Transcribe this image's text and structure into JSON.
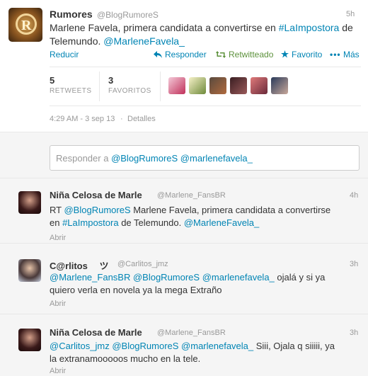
{
  "main_tweet": {
    "name": "Rumores",
    "handle": "@BlogRumoreS",
    "time": "5h",
    "text_parts": [
      "Marlene Favela, primera candidata a convertirse en ",
      "#LaImpostora",
      " de",
      "Telemundo. ",
      "@MarleneFavela_"
    ],
    "actions": {
      "collapse": "Reducir",
      "reply": "Responder",
      "retweeted": "Retwitteado",
      "favorite": "Favorito",
      "more": "Más"
    },
    "stats": {
      "retweets_count": "5",
      "retweets_label": "RETWEETS",
      "favorites_count": "3",
      "favorites_label": "FAVORITOS"
    },
    "timestamp": "4:29 AM - 3 sep 13",
    "details": "Detalles"
  },
  "reply_box": {
    "prefix": "Responder a ",
    "mentions": "@BlogRumoreS @marlenefavela_"
  },
  "replies": [
    {
      "name": "Niña Celosa de Marle",
      "handle": "@Marlene_FansBR",
      "time": "4h",
      "line1_parts": [
        "RT ",
        "@BlogRumoreS",
        " Marlene Favela, primera candidata a convertirse"
      ],
      "line2_parts": [
        "en ",
        "#LaImpostora",
        " de Telemundo. ",
        "@MarleneFavela_"
      ],
      "open": "Abrir"
    },
    {
      "name": "C@rlitos  ツ",
      "handle": "@Carlitos_jmz",
      "time": "3h",
      "line1_parts": [
        "@Marlene_FansBR @BlogRumoreS @marlenefavela_",
        " ojalá y si ya"
      ],
      "line2_parts": [
        "quiero verla en novela ya la mega Extraño"
      ],
      "open": "Abrir"
    },
    {
      "name": "Niña Celosa de Marle",
      "handle": "@Marlene_FansBR",
      "time": "3h",
      "line1_parts": [
        "@Carlitos_jmz @BlogRumoreS @marlenefavela_",
        " Siii, Ojala q siiiii, ya"
      ],
      "line2_parts": [
        "la extranamooooos mucho en la tele."
      ],
      "open": "Abrir"
    }
  ]
}
